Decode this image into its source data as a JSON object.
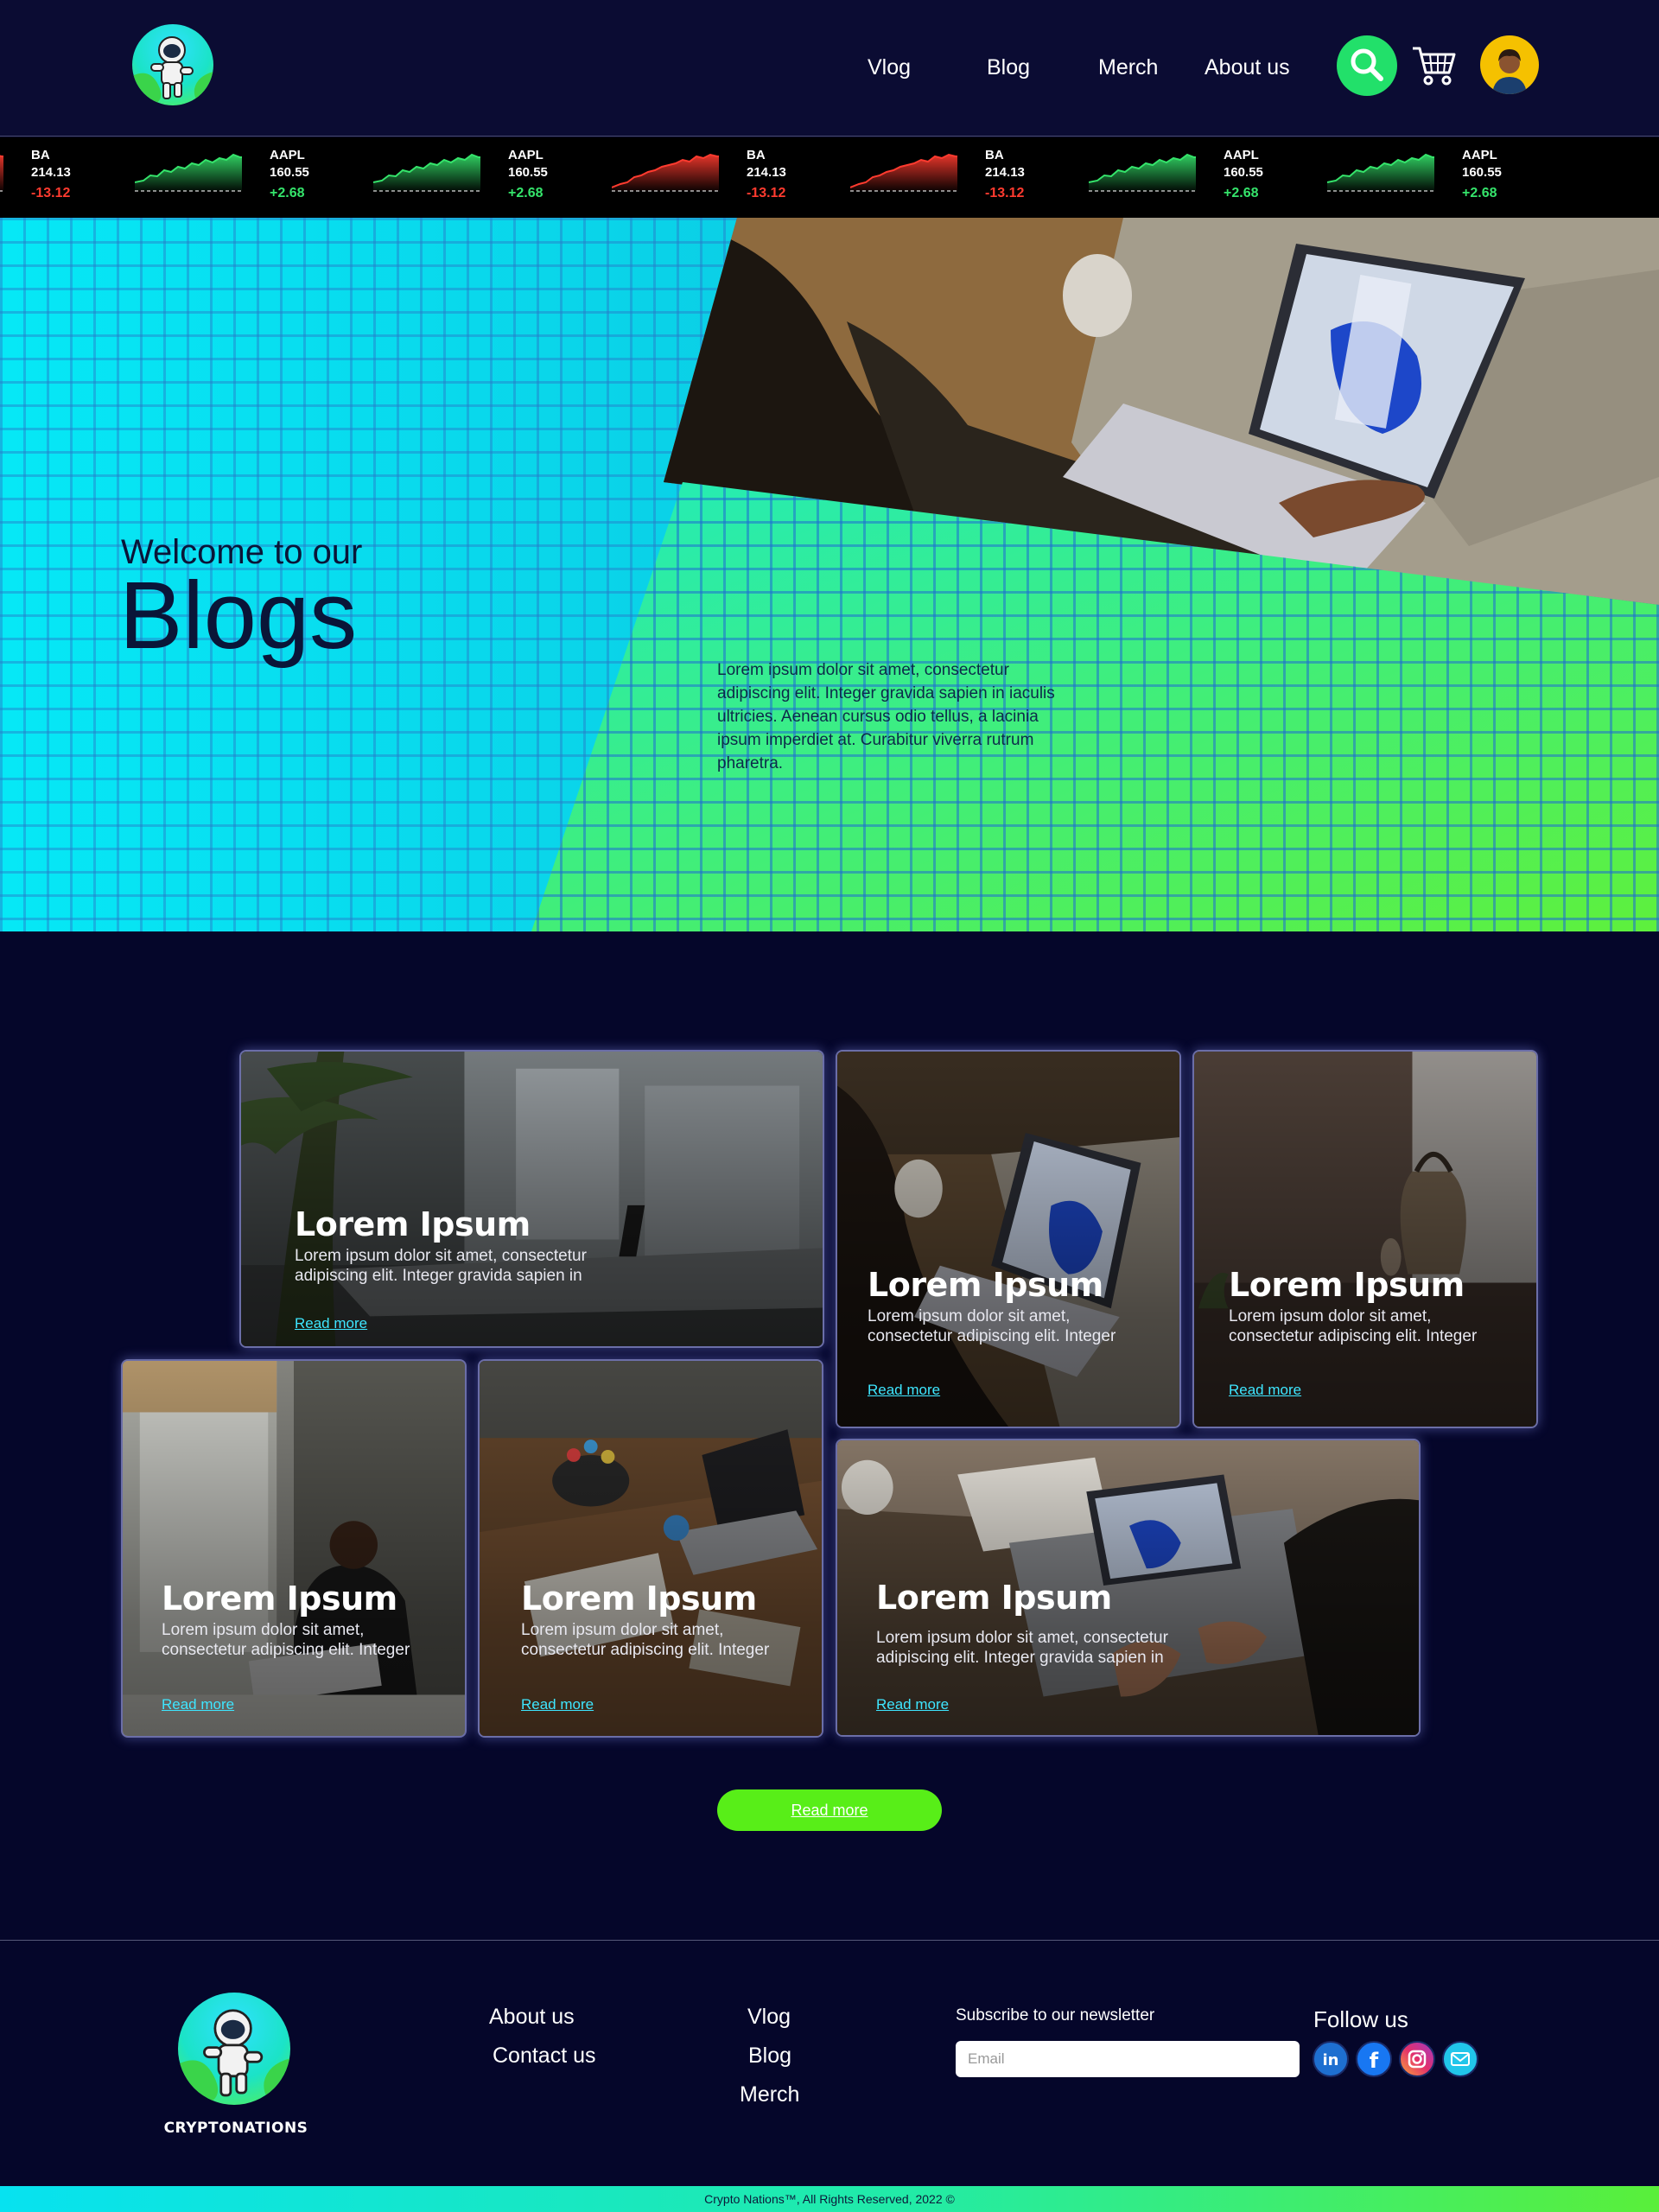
{
  "header": {
    "nav": [
      "Vlog",
      "Blog",
      "Merch",
      "About us"
    ]
  },
  "ticker": [
    {
      "symbol": "BA",
      "price": "214.13",
      "change": "-13.12",
      "trend": "down"
    },
    {
      "symbol": "AAPL",
      "price": "160.55",
      "change": "+2.68",
      "trend": "up"
    },
    {
      "symbol": "AAPL",
      "price": "160.55",
      "change": "+2.68",
      "trend": "up"
    },
    {
      "symbol": "BA",
      "price": "214.13",
      "change": "-13.12",
      "trend": "down"
    },
    {
      "symbol": "BA",
      "price": "214.13",
      "change": "-13.12",
      "trend": "down"
    },
    {
      "symbol": "AAPL",
      "price": "160.55",
      "change": "+2.68",
      "trend": "up"
    },
    {
      "symbol": "AAPL",
      "price": "160.55",
      "change": "+2.68",
      "trend": "up"
    }
  ],
  "hero": {
    "welcome": "Welcome to our",
    "title": "Blogs",
    "text": "Lorem ipsum dolor sit amet, consectetur adipiscing elit. Integer gravida sapien in iaculis ultricies. Aenean cursus odio tellus, a lacinia ipsum imperdiet at. Curabitur viverra rutrum pharetra."
  },
  "cards": [
    {
      "title": "Lorem Ipsum",
      "text": "Lorem ipsum dolor sit amet, consectetur adipiscing elit. Integer gravida sapien in",
      "link": "Read more"
    },
    {
      "title": "Lorem Ipsum",
      "text": "Lorem ipsum dolor sit amet, consectetur adipiscing elit. Integer",
      "link": "Read more"
    },
    {
      "title": "Lorem Ipsum",
      "text": "Lorem ipsum dolor sit amet, consectetur adipiscing elit. Integer",
      "link": "Read more"
    },
    {
      "title": "Lorem Ipsum",
      "text": "Lorem ipsum dolor sit amet, consectetur adipiscing elit. Integer",
      "link": "Read more"
    },
    {
      "title": "Lorem Ipsum",
      "text": "Lorem ipsum dolor sit amet, consectetur adipiscing elit. Integer",
      "link": "Read more"
    },
    {
      "title": "Lorem Ipsum",
      "text": "Lorem ipsum dolor sit amet, consectetur adipiscing elit. Integer gravida sapien in",
      "link": "Read more"
    }
  ],
  "main_button": "Read more",
  "footer": {
    "brand": "CRYPTONATIONS",
    "col1": [
      "About us",
      "Contact us"
    ],
    "col2": [
      "Vlog",
      "Blog",
      "Merch"
    ],
    "newsletter_label": "Subscribe to our newsletter",
    "email_placeholder": "Email",
    "follow_label": "Follow us",
    "social_icons": [
      "linkedin-icon",
      "facebook-icon",
      "instagram-icon",
      "email-icon"
    ],
    "copyright": "Crypto Nations™, All Rights Reserved, 2022 ©"
  },
  "colors": {
    "background": "#05062a",
    "accent_green": "#58ee18",
    "accent_cyan": "#06e8f6",
    "link": "#3ee6ff",
    "up": "#35e46b",
    "down": "#ff3b2f"
  }
}
